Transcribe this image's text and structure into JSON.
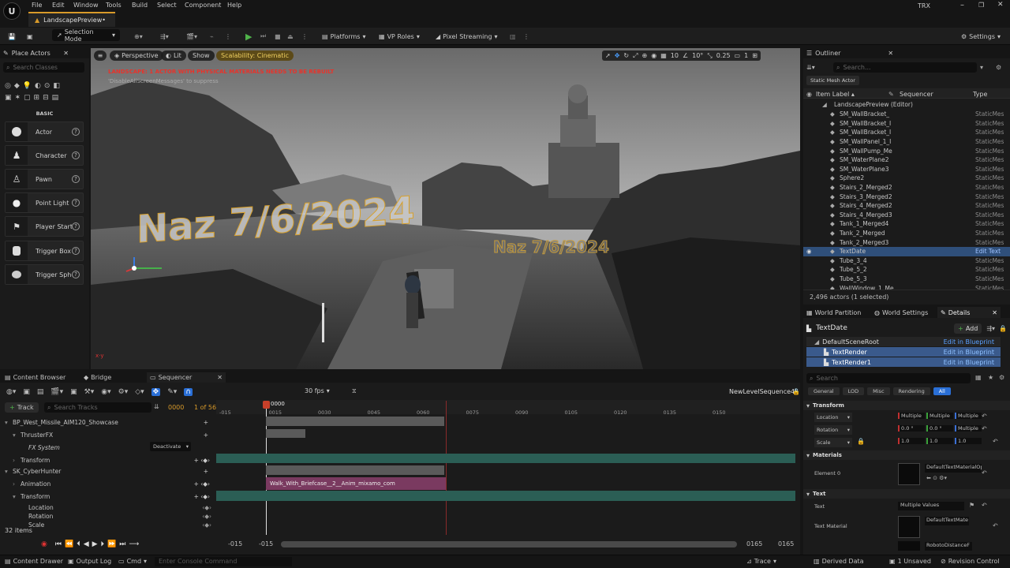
{
  "menu": {
    "items": [
      "File",
      "Edit",
      "Window",
      "Tools",
      "Build",
      "Select",
      "Component",
      "Help"
    ],
    "project": "TRX"
  },
  "doc_tab": "LandscapePreview•",
  "toolbar": {
    "selection_mode": "Selection Mode",
    "platforms": "Platforms",
    "vp_roles": "VP Roles",
    "pixel_streaming": "Pixel Streaming",
    "settings": "Settings"
  },
  "place_actors": {
    "title": "Place Actors",
    "search_placeholder": "Search Classes",
    "section": "BASIC",
    "items": [
      "Actor",
      "Character",
      "Pawn",
      "Point Light",
      "Player Start",
      "Trigger Box",
      "Trigger Sphe"
    ]
  },
  "viewport": {
    "perspective": "Perspective",
    "lit": "Lit",
    "show": "Show",
    "scalability": "Scalability: Cinematic",
    "warning": "LANDSCAPE: 1 ACTOR WITH PHYSICAL MATERIALS NEEDS TO BE REBUILT",
    "warning_sub": "'DisableAllScreenMessages' to suppress",
    "grid": "10",
    "angle": "10°",
    "scale": "0.25",
    "cams": "1",
    "text_big": "Naz 7/6/2024",
    "text_small": "Naz 7/6/2024"
  },
  "outliner": {
    "title": "Outliner",
    "search_placeholder": "Search...",
    "filter_chip": "Static Mesh Actor",
    "col_label": "Item Label ▴",
    "col_sequencer": "Sequencer",
    "col_type": "Type",
    "root": "LandscapePreview (Editor)",
    "rows": [
      {
        "name": "SM_WallBracket_",
        "type": "StaticMes"
      },
      {
        "name": "SM_WallBracket_I",
        "type": "StaticMes"
      },
      {
        "name": "SM_WallBracket_I",
        "type": "StaticMes"
      },
      {
        "name": "SM_WallPanel_1_I",
        "type": "StaticMes"
      },
      {
        "name": "SM_WallPump_Me",
        "type": "StaticMes"
      },
      {
        "name": "SM_WaterPlane2",
        "type": "StaticMes"
      },
      {
        "name": "SM_WaterPlane3",
        "type": "StaticMes"
      },
      {
        "name": "Sphere2",
        "type": "StaticMes"
      },
      {
        "name": "Stairs_2_Merged2",
        "type": "StaticMes"
      },
      {
        "name": "Stairs_3_Merged2",
        "type": "StaticMes"
      },
      {
        "name": "Stairs_4_Merged2",
        "type": "StaticMes"
      },
      {
        "name": "Stairs_4_Merged3",
        "type": "StaticMes"
      },
      {
        "name": "Tank_1_Merged4",
        "type": "StaticMes"
      },
      {
        "name": "Tank_2_Merged",
        "type": "StaticMes"
      },
      {
        "name": "Tank_2_Merged3",
        "type": "StaticMes"
      },
      {
        "name": "TextDate",
        "type": "Edit Text"
      },
      {
        "name": "Tube_3_4",
        "type": "StaticMes"
      },
      {
        "name": "Tube_5_2",
        "type": "StaticMes"
      },
      {
        "name": "Tube_5_3",
        "type": "StaticMes"
      },
      {
        "name": "WallWindow_1_Me",
        "type": "StaticMes"
      }
    ],
    "count": "2,496 actors (1 selected)"
  },
  "details": {
    "tabs": [
      "World Partition",
      "World Settings",
      "Details"
    ],
    "object": "TextDate",
    "add": "Add",
    "components": [
      {
        "name": "DefaultSceneRoot",
        "link": "Edit in Blueprint"
      },
      {
        "name": "TextRender",
        "link": "Edit in Blueprint"
      },
      {
        "name": "TextRender1",
        "link": "Edit in Blueprint"
      }
    ],
    "search_placeholder": "Search",
    "filters": [
      "General",
      "LOD",
      "Misc",
      "Rendering",
      "All"
    ],
    "transform": "Transform",
    "location": "Location",
    "rotation": "Rotation",
    "scale": "Scale",
    "loc_vals": [
      "Multiple",
      "Multiple",
      "Multiple"
    ],
    "rot_vals": [
      "0.0 °",
      "0.0 °",
      "Multiple"
    ],
    "scale_vals": [
      "1.0",
      "1.0",
      "1.0"
    ],
    "materials": "Materials",
    "element0": "Element 0",
    "mat_name": "DefaultTextMaterialOp",
    "text_section": "Text",
    "text_label": "Text",
    "text_value": "Multiple Values",
    "text_material": "Text Material",
    "text_mat_name": "DefaultTextMate",
    "font_name": "RobotoDistanceF"
  },
  "sequencer": {
    "tabs": [
      "Content Browser",
      "Bridge",
      "Sequencer"
    ],
    "fps": "30 fps",
    "sequence_name": "NewLevelSequence45",
    "track_btn": "Track",
    "search_placeholder": "Search Tracks",
    "frame": "0000",
    "range": "1 of 56",
    "playhead": "0000",
    "ruler": [
      "-015",
      "0015",
      "0030",
      "0045",
      "0060",
      "0075",
      "0090",
      "0105",
      "0120",
      "0135",
      "0150"
    ],
    "tracks": [
      {
        "name": "BP_West_Missile_AIM120_Showcase",
        "indent": 0
      },
      {
        "name": "ThrusterFX",
        "indent": 1
      },
      {
        "name": "FX System",
        "indent": 2
      },
      {
        "name": "Transform",
        "indent": 1
      },
      {
        "name": "SK_CyberHunter",
        "indent": 0
      },
      {
        "name": "Animation",
        "indent": 1
      },
      {
        "name": "Transform",
        "indent": 1
      },
      {
        "name": "Location",
        "indent": 2
      },
      {
        "name": "Rotation",
        "indent": 2
      },
      {
        "name": "Scale",
        "indent": 2
      }
    ],
    "deactivate": "Deactivate",
    "anim_clip": "Walk_With_Briefcase__2__Anim_mixamo_com",
    "items": "32 items",
    "range_start": "-015",
    "range_start2": "-015",
    "range_end": "0165",
    "range_end2": "0165"
  },
  "statusbar": {
    "content_drawer": "Content Drawer",
    "output_log": "Output Log",
    "cmd": "Cmd",
    "console_placeholder": "Enter Console Command",
    "trace": "Trace",
    "derived": "Derived Data",
    "unsaved": "1 Unsaved",
    "revision": "Revision Control"
  }
}
